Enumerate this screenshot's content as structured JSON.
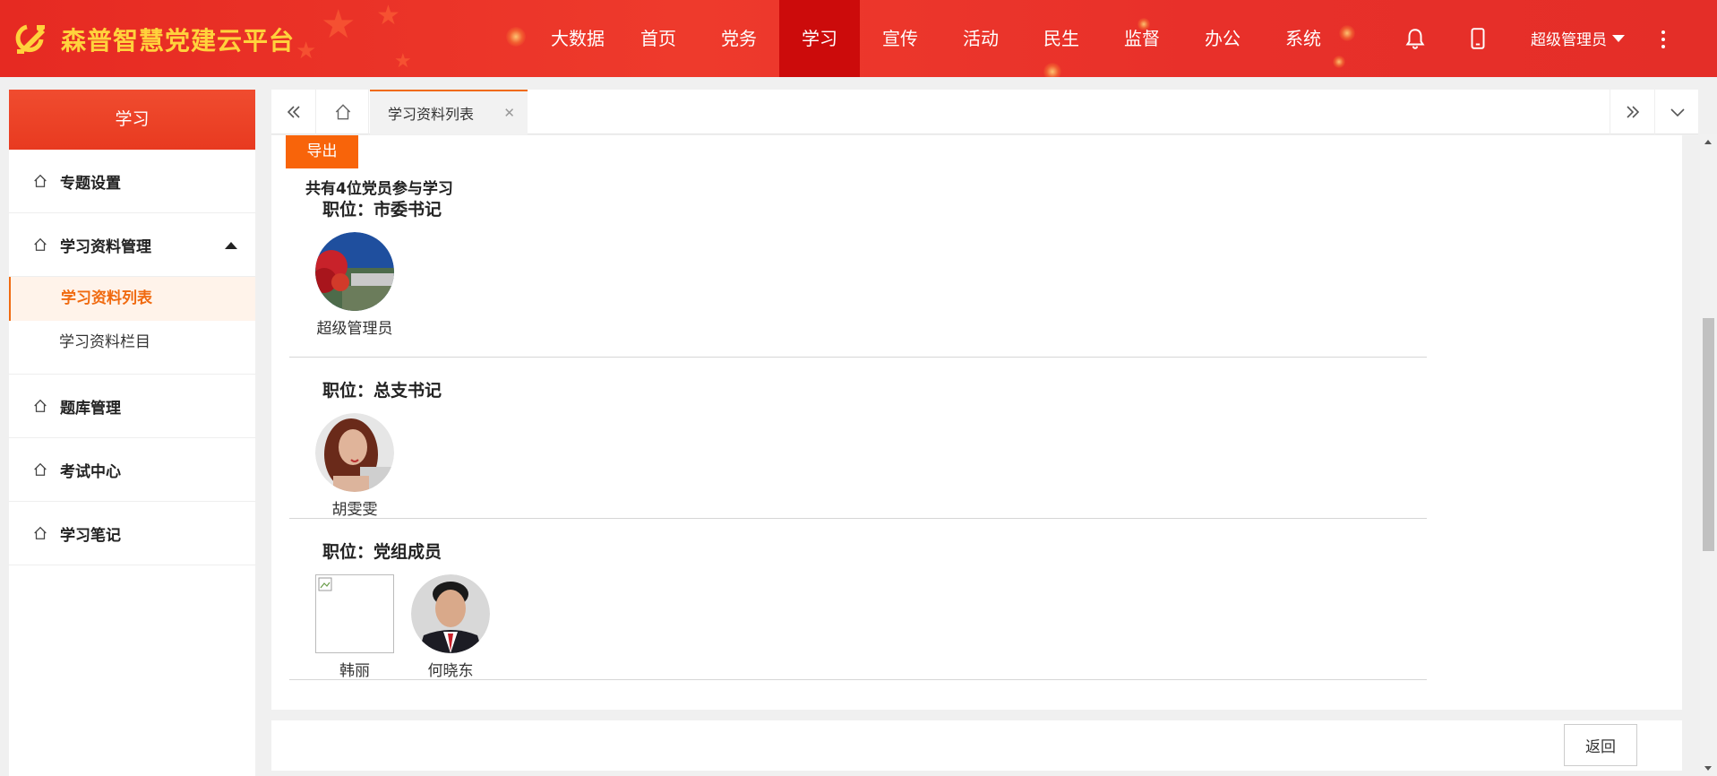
{
  "header": {
    "brand": "森普智慧党建云平台",
    "nav": [
      "大数据",
      "首页",
      "党务",
      "学习",
      "宣传",
      "活动",
      "民生",
      "监督",
      "办公",
      "系统"
    ],
    "active_nav": "学习",
    "user": "超级管理员",
    "icons": [
      "bell-icon",
      "mobile-icon",
      "more-vertical-icon"
    ]
  },
  "sidebar": {
    "title": "学习",
    "items": [
      {
        "label": "专题设置"
      },
      {
        "label": "学习资料管理",
        "expanded": true,
        "children": [
          "学习资料列表",
          "学习资料栏目"
        ],
        "active_child": "学习资料列表"
      },
      {
        "label": "题库管理"
      },
      {
        "label": "考试中心"
      },
      {
        "label": "学习笔记"
      }
    ]
  },
  "tabs": {
    "active": "学习资料列表"
  },
  "content": {
    "export_label": "导出",
    "count_text": "共有4位党员参与学习",
    "positions": [
      {
        "title": "职位：市委书记",
        "members": [
          {
            "name": "超级管理员",
            "avatar": "photo-landscape-red-tree"
          }
        ]
      },
      {
        "title": "职位：总支书记",
        "members": [
          {
            "name": "胡雯雯",
            "avatar": "photo-woman-portrait"
          }
        ]
      },
      {
        "title": "职位：党组成员",
        "members": [
          {
            "name": "韩丽",
            "avatar": "broken-image"
          },
          {
            "name": "何晓东",
            "avatar": "photo-man-suit"
          }
        ]
      }
    ]
  },
  "footer": {
    "back_label": "返回"
  },
  "colors": {
    "header_red": "#e62a22",
    "brand_yellow": "#ffd23c",
    "active_nav": "#cc0b0b",
    "accent_orange": "#f8640a"
  }
}
